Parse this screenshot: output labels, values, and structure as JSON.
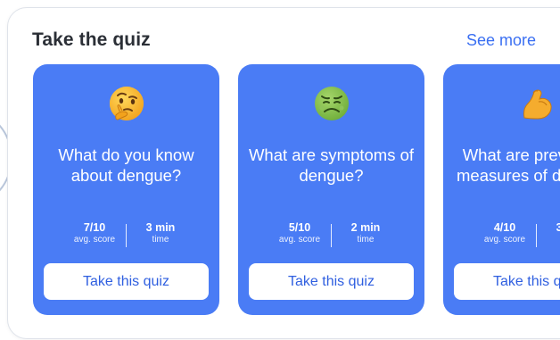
{
  "header": {
    "title": "Take the quiz",
    "see_more": "See more"
  },
  "colors": {
    "card_bg": "#4a7cf5",
    "accent": "#3a6ff2",
    "button_text": "#2f5fe0"
  },
  "cards": [
    {
      "emoji_icon": "thinking-face-icon",
      "emoji": "🤔",
      "question": "What do you know about dengue?",
      "score": "7/10",
      "score_label": "avg. score",
      "time": "3 min",
      "time_label": "time",
      "button": "Take this quiz"
    },
    {
      "emoji_icon": "nauseated-face-icon",
      "emoji": "🤢",
      "question": "What are symptoms of dengue?",
      "score": "5/10",
      "score_label": "avg. score",
      "time": "2 min",
      "time_label": "time",
      "button": "Take this quiz"
    },
    {
      "emoji_icon": "flexed-biceps-icon",
      "emoji": "💪",
      "question": "What are preventive measures of dengue?",
      "score": "4/10",
      "score_label": "avg. score",
      "time": "3 min",
      "time_label": "time",
      "button": "Take this quiz"
    }
  ]
}
